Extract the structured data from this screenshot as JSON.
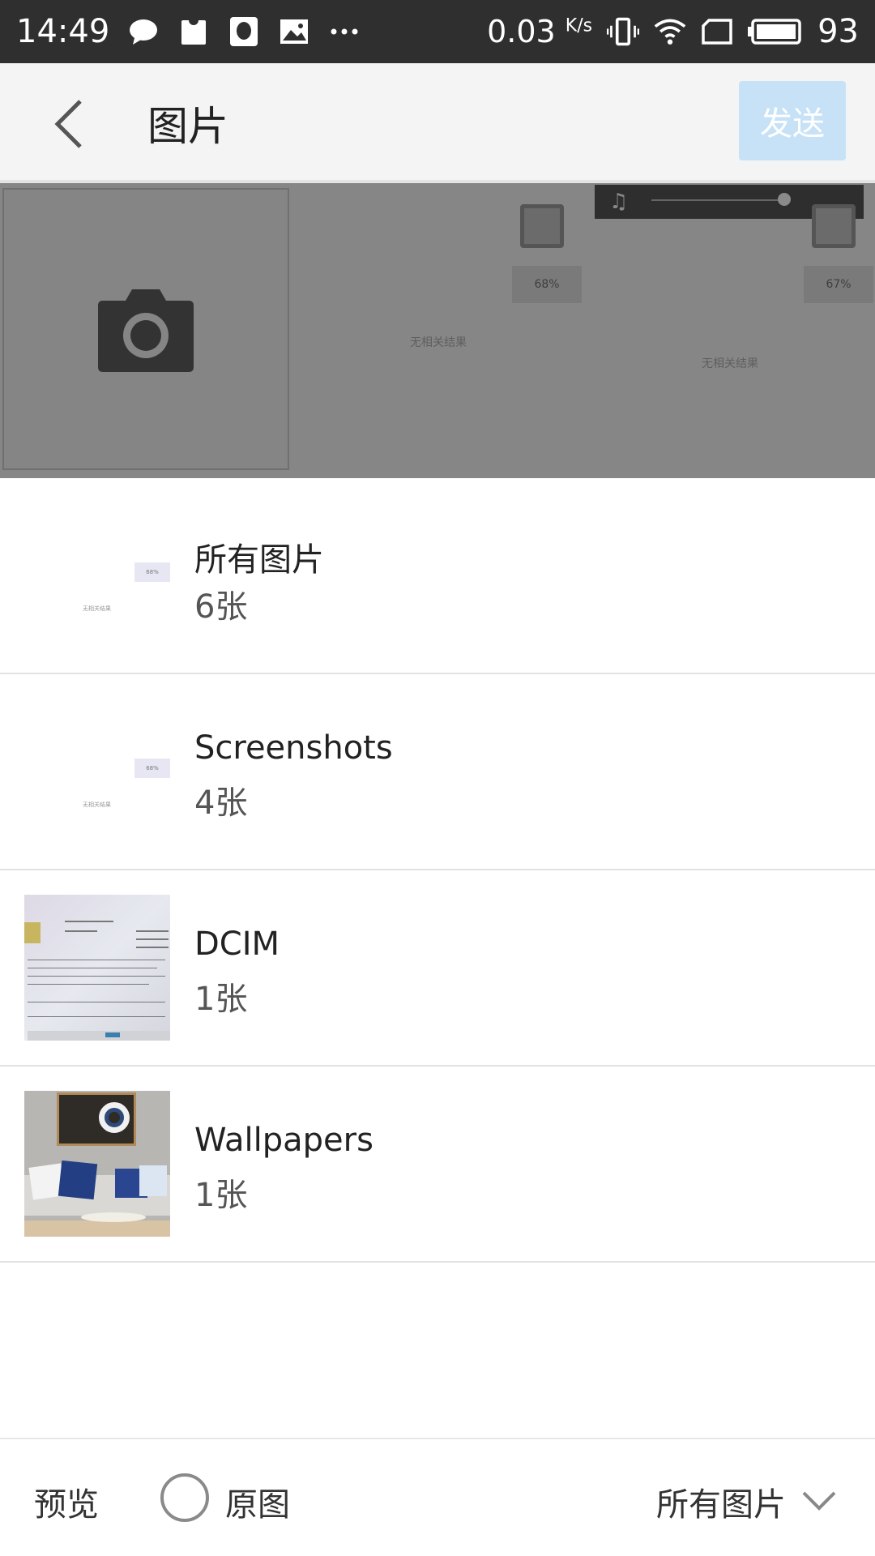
{
  "status_bar": {
    "time": "14:49",
    "net_speed": "0.03",
    "net_unit": "K/s",
    "battery": "93",
    "icons": [
      "chat-bubble-icon",
      "shirt-icon",
      "qq-icon",
      "image-icon",
      "more-dots-icon",
      "vibrate-icon",
      "wifi-icon",
      "sim-icon",
      "battery-icon"
    ]
  },
  "header": {
    "title": "图片",
    "send_label": "发送"
  },
  "gallery": {
    "thumb_1": {
      "percent": "68%",
      "no_result": "无相关结果"
    },
    "thumb_2": {
      "percent": "67%",
      "no_result": "无相关结果"
    }
  },
  "albums": [
    {
      "name": "所有图片",
      "count": "6张",
      "thumb": "screenshot",
      "thumb_percent": "68%",
      "thumb_text": "无相关结果"
    },
    {
      "name": "Screenshots",
      "count": "4张",
      "thumb": "screenshot",
      "thumb_percent": "68%",
      "thumb_text": "无相关结果"
    },
    {
      "name": "DCIM",
      "count": "1张",
      "thumb": "document-photo"
    },
    {
      "name": "Wallpapers",
      "count": "1张",
      "thumb": "living-room-photo"
    }
  ],
  "bottom_bar": {
    "preview_label": "预览",
    "original_label": "原图",
    "album_selector": "所有图片"
  },
  "colors": {
    "status_bar_bg": "#2f2f2f",
    "header_bg": "#f4f4f4",
    "send_button_bg": "#c7e2f6",
    "overlay_bg": "#868686"
  }
}
